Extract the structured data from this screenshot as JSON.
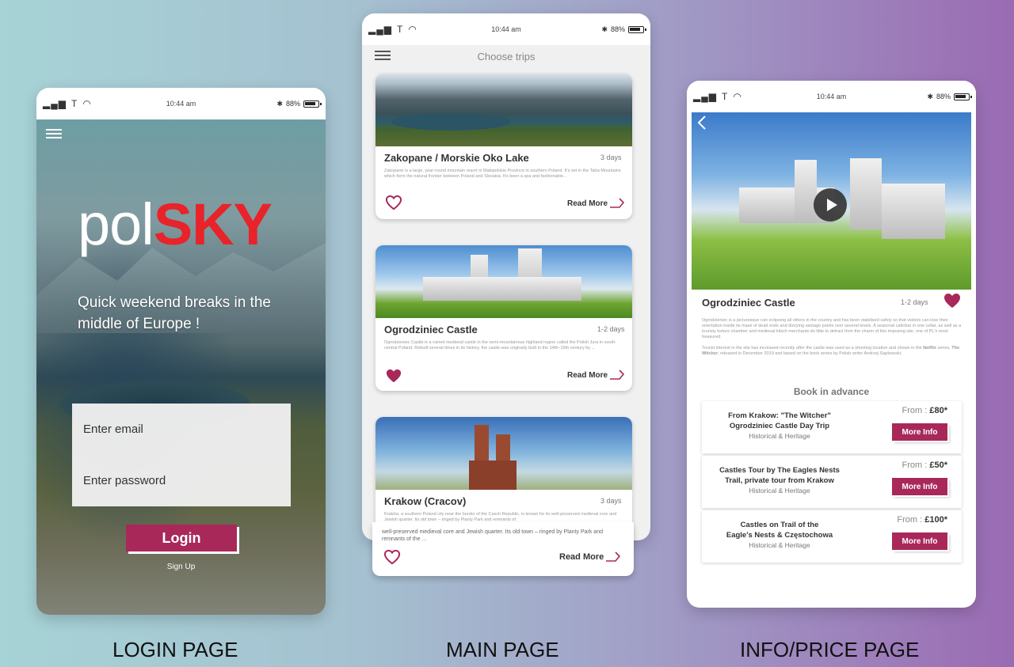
{
  "status": {
    "time": "10:44 am",
    "battery": "88%"
  },
  "login": {
    "logo_pol": "pol",
    "logo_sky": "SKY",
    "tagline": "Quick weekend breaks in the middle of Europe !",
    "email_placeholder": "Enter email",
    "password_placeholder": "Enter password",
    "login_label": "Login",
    "signup_label": "Sign Up"
  },
  "main": {
    "title": "Choose trips",
    "cards": [
      {
        "title": "Zakopane / Morskie Oko Lake",
        "days": "3 days",
        "desc": "Zakopane is a large, year-round mountain resort in Małopolskie Province in southern Poland. It's set in the Tatra Mountains which form the natural frontier between Poland and Slovakia. It's been a spa and fashionable...",
        "read_more": "Read More",
        "liked": false
      },
      {
        "title": "Ogrodziniec Castle",
        "days": "1-2 days",
        "desc": "Ogrodzieniec Castle is a ruined medieval castle in the semi-mountainous highland region called the Polish Jura in south-central Poland. Rebuilt several times in its history, the castle was originally built in the 14th–15th century by ...",
        "read_more": "Read More",
        "liked": true
      },
      {
        "title": "Krakow (Cracov)",
        "days": "3 days",
        "desc": "Kraków, a southern Poland city near the border of the Czech Republic, is known for its well-preserved medieval core and Jewish quarter. Its old town – ringed by Planty Park and remnants of",
        "desc_overflow": "well-preserved medieval core and Jewish quarter. Its old town – ringed by Planty Park and remnants of the ...",
        "read_more": "Read More",
        "liked": false
      }
    ]
  },
  "info": {
    "title": "Ogrodziniec Castle",
    "days": "1-2 days",
    "desc1": "Ogrodzieniec is a picturesque ruin eclipsing all others in the country and has been stabilised safely so that visitors can lose their orientation inside its maze of dead ends and dizzying vantage points over several levels. A seasonal cafe/bar in one cellar, as well as a touristy torture chamber and medieval kitsch merchants do little to detract from the charm of this imposing site, one of PL's most treasured.",
    "desc2_a": "Tourist interest in the site has increased recently after the castle was used as a shooting location and shown in the ",
    "desc2_netflix": "Netflix",
    "desc2_b": " series, ",
    "desc2_witcher": "The Witcher",
    "desc2_c": ", released in December 2019 and based on the book series by Polish writer Andrzej Sapkowski.",
    "book_heading": "Book in advance",
    "from_label": "From : ",
    "more_info": "More Info",
    "offers": [
      {
        "line1": "From Krakow: \"The Witcher\"",
        "line2": "Ogrodziniec Castle Day Trip",
        "sub": "Historical & Heritage",
        "price": "£80*"
      },
      {
        "line1": "Castles Tour by The Eagles Nests",
        "line2": "Trail, private tour from Krakow",
        "sub": "Historical & Heritage",
        "price": "£50*"
      },
      {
        "line1": "Castles on Trail of the",
        "line2": "Eagle's Nests & Częstochowa",
        "sub": "Historical & Heritage",
        "price": "£100*"
      }
    ]
  },
  "captions": {
    "login": "LOGIN PAGE",
    "main": "MAIN PAGE",
    "info": "INFO/PRICE PAGE"
  },
  "colors": {
    "accent": "#a8285a",
    "brand_red": "#e8232a"
  }
}
